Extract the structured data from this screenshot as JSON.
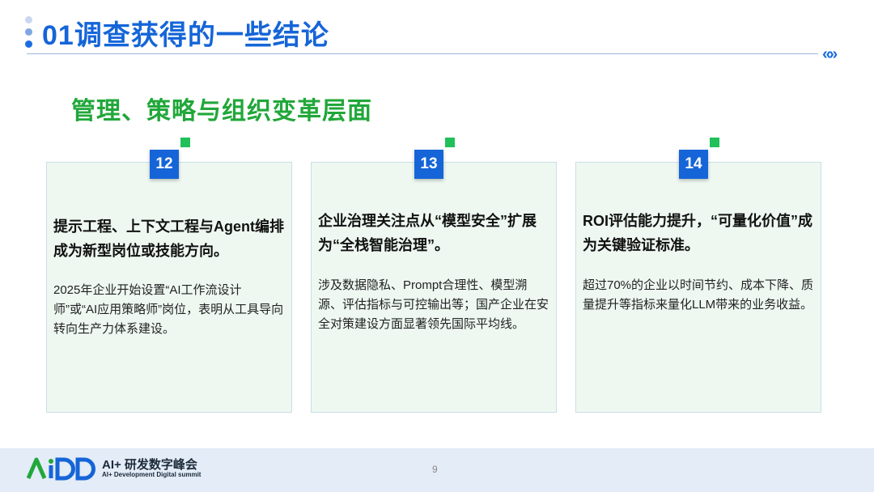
{
  "header": {
    "title": "01调查获得的一些结论",
    "nav_arrows": "«»"
  },
  "section": {
    "title": "管理、策略与组织变革层面"
  },
  "cards": [
    {
      "number": "12",
      "heading": "提示工程、上下文工程与Agent编排成为新型岗位或技能方向。",
      "body": "2025年企业开始设置“AI工作流设计师”或“AI应用策略师”岗位，表明从工具导向转向生产力体系建设。"
    },
    {
      "number": "13",
      "heading": "企业治理关注点从“模型安全”扩展为“全栈智能治理”。",
      "body": "涉及数据隐私、Prompt合理性、模型溯源、评估指标与可控输出等；国产企业在安全对策建设方面显著领先国际平均线。"
    },
    {
      "number": "14",
      "heading": "ROI评估能力提升，“可量化价值”成为关键验证标准。",
      "body": "超过70%的企业以时间节约、成本下降、质量提升等指标来量化LLM带来的业务收益。"
    }
  ],
  "footer": {
    "logo_text": "AiDD",
    "brand_name": "AI+ 研发数字峰会",
    "brand_sub": "AI+ Development Digital summit",
    "page_number": "9"
  },
  "colors": {
    "title_blue": "#1565d8",
    "section_green": "#21a73a",
    "badge_blue": "#1565d8",
    "badge_dot_green": "#21c05a",
    "card_bg": "#eef8f1"
  }
}
